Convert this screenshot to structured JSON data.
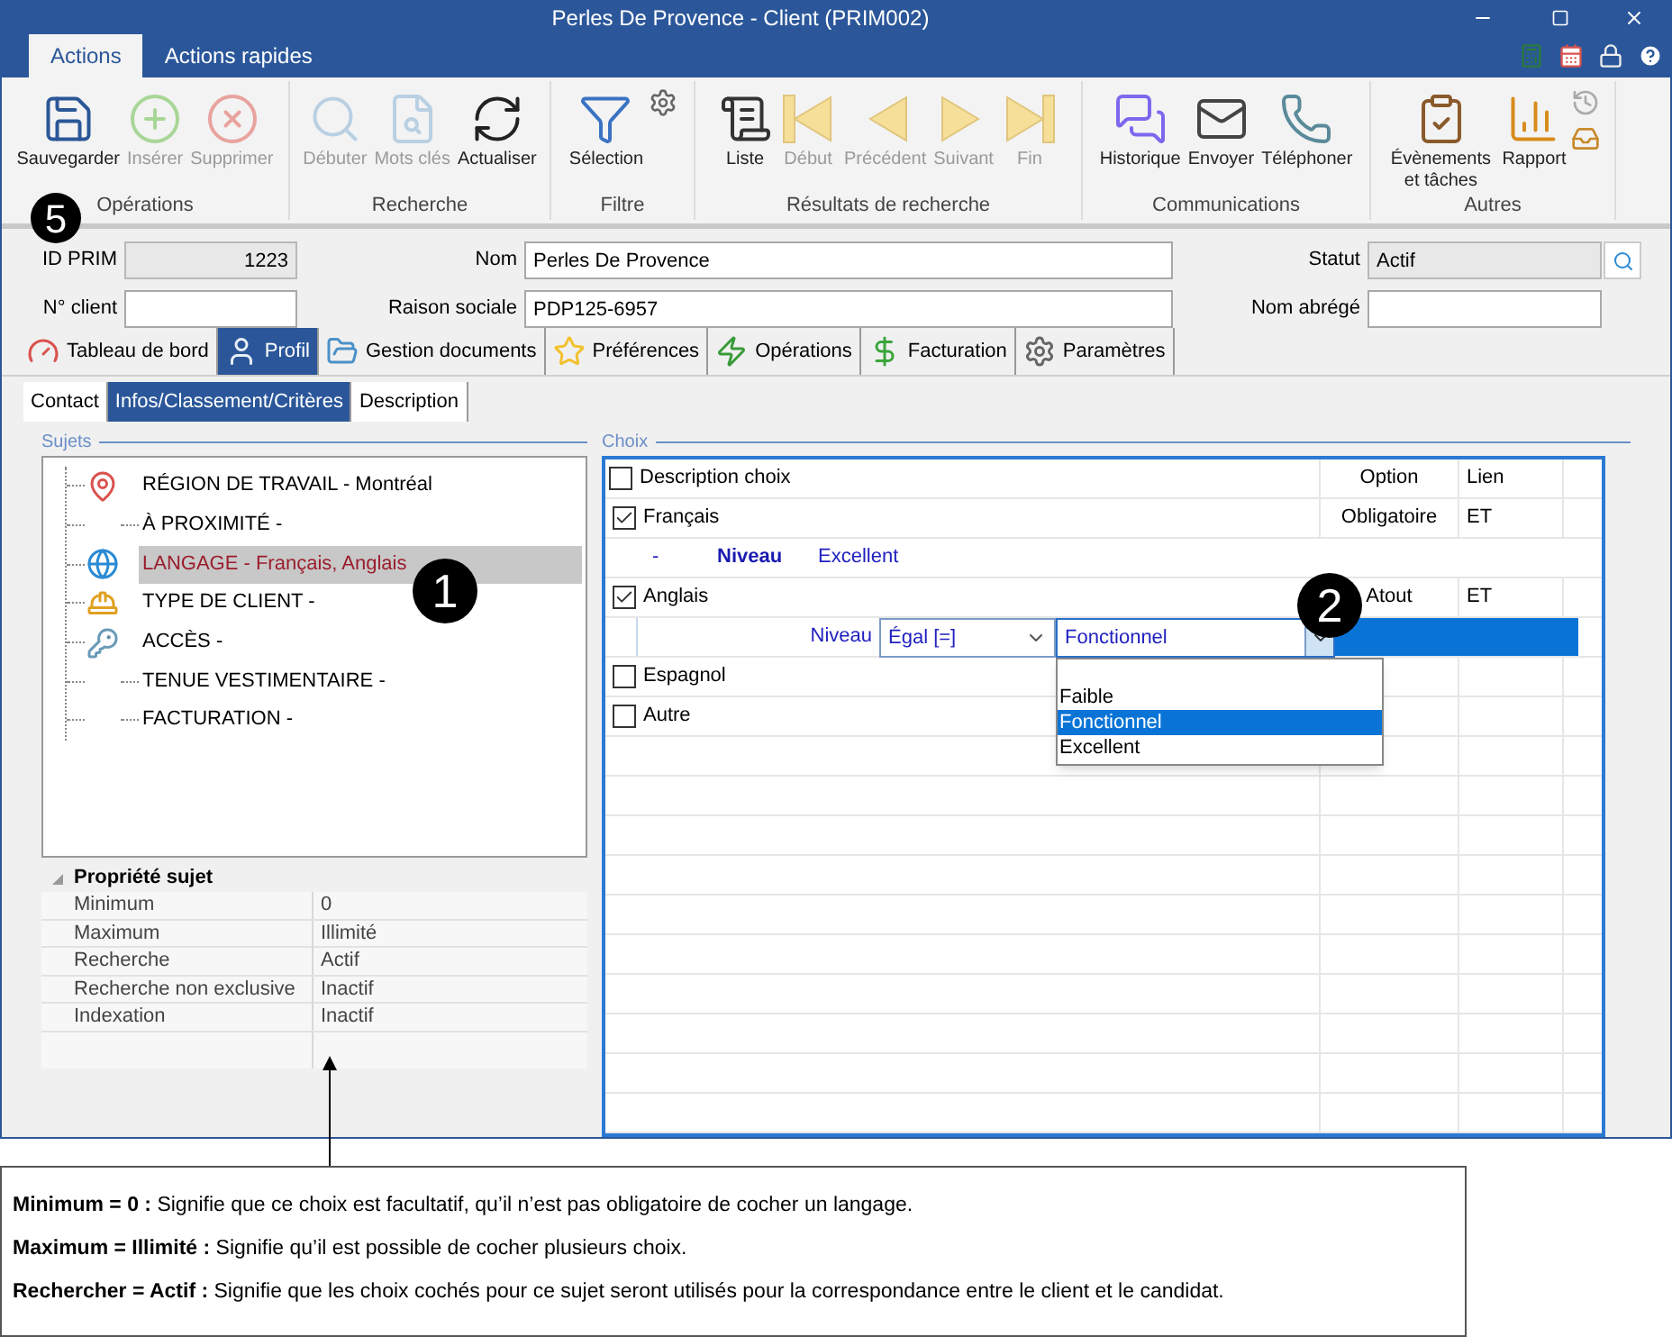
{
  "window": {
    "title": "Perles De Provence - Client (PRIM002)"
  },
  "ribbon_tabs": [
    {
      "label": "Actions",
      "selected": true
    },
    {
      "label": "Actions rapides",
      "selected": false
    }
  ],
  "ribbon_groups": [
    {
      "label": "Opérations",
      "buttons": [
        {
          "label": "Sauvegarder",
          "kind": "save",
          "disabled": false
        },
        {
          "label": "Insérer",
          "kind": "add",
          "disabled": true
        },
        {
          "label": "Supprimer",
          "kind": "delete",
          "disabled": true
        }
      ]
    },
    {
      "label": "Recherche",
      "buttons": [
        {
          "label": "Débuter",
          "kind": "search",
          "disabled": true
        },
        {
          "label": "Mots clés",
          "kind": "keywords",
          "disabled": true
        },
        {
          "label": "Actualiser",
          "kind": "refresh",
          "disabled": false
        }
      ]
    },
    {
      "label": "Filtre",
      "buttons": [
        {
          "label": "Sélection",
          "kind": "filter",
          "disabled": false
        },
        {
          "kind": "gear-small",
          "disabled": false
        }
      ]
    },
    {
      "label": "Résultats de recherche",
      "buttons": [
        {
          "label": "Liste",
          "kind": "list",
          "disabled": false
        },
        {
          "label": "Début",
          "kind": "first",
          "disabled": true
        },
        {
          "label": "Précédent",
          "kind": "prev",
          "disabled": true
        },
        {
          "label": "Suivant",
          "kind": "next",
          "disabled": true
        },
        {
          "label": "Fin",
          "kind": "last",
          "disabled": true
        }
      ]
    },
    {
      "label": "Communications",
      "buttons": [
        {
          "label": "Historique",
          "kind": "history",
          "disabled": false
        },
        {
          "label": "Envoyer",
          "kind": "send",
          "disabled": false
        },
        {
          "label": "Téléphoner",
          "kind": "phone",
          "disabled": false
        }
      ]
    },
    {
      "label": "Autres",
      "buttons": [
        {
          "label": "Évènements et tâches",
          "kind": "tasks",
          "disabled": false
        },
        {
          "label": "Rapport",
          "kind": "report",
          "disabled": false
        },
        {
          "kind": "stack-small",
          "disabled": false
        }
      ]
    }
  ],
  "fields": [
    {
      "label": "ID PRIM",
      "value": "1223",
      "readonly": true
    },
    {
      "label": "Nom",
      "value": "Perles De Provence",
      "readonly": false
    },
    {
      "label": "Statut",
      "value": "Actif",
      "readonly": true
    },
    {
      "label": "N° client",
      "readonly": false
    },
    {
      "label": "Raison sociale",
      "value": "PDP125-6957",
      "readonly": false
    },
    {
      "label": "Nom abrégé",
      "readonly": false
    }
  ],
  "tabs": [
    {
      "label": "Tableau de bord",
      "kind": "dashboard",
      "selected": false
    },
    {
      "label": "Profil",
      "kind": "user",
      "selected": true
    },
    {
      "label": "Gestion documents",
      "kind": "folder",
      "selected": false
    },
    {
      "label": "Préférences",
      "kind": "star",
      "selected": false
    },
    {
      "label": "Opérations",
      "kind": "operations",
      "selected": false
    },
    {
      "label": "Facturation",
      "kind": "dollar",
      "selected": false
    },
    {
      "label": "Paramètres",
      "kind": "gear",
      "selected": false
    }
  ],
  "subtabs": [
    {
      "label": "Contact",
      "selected": false
    },
    {
      "label": "Infos/Classement/Critères",
      "selected": true
    },
    {
      "label": "Description",
      "selected": false
    }
  ],
  "sujets": {
    "title": "Sujets",
    "items": [
      {
        "label": "RÉGION DE TRAVAIL - Montréal",
        "kind": "pin",
        "selected": false
      },
      {
        "label": "À PROXIMITÉ -",
        "kind": "none",
        "selected": false
      },
      {
        "label": "LANGAGE - Français, Anglais",
        "kind": "globe",
        "selected": true
      },
      {
        "label": "TYPE DE CLIENT -",
        "kind": "worker",
        "selected": false
      },
      {
        "label": "ACCÈS -",
        "kind": "key",
        "selected": false
      },
      {
        "label": "TENUE VESTIMENTAIRE -",
        "kind": "none",
        "selected": false
      },
      {
        "label": "FACTURATION -",
        "kind": "none",
        "selected": false
      }
    ]
  },
  "property_grid": {
    "title": "Propriété sujet",
    "rows": [
      {
        "name": "Minimum",
        "value": "0"
      },
      {
        "name": "Maximum",
        "value": "Illimité"
      },
      {
        "name": "Recherche",
        "value": "Actif"
      },
      {
        "name": "Recherche non exclusive",
        "value": "Inactif"
      },
      {
        "name": "Indexation",
        "value": "Inactif"
      }
    ]
  },
  "choix": {
    "title": "Choix",
    "header": {
      "checked": false,
      "label": "Description choix",
      "option": "Option",
      "lien": "Lien"
    },
    "rows": [
      {
        "kind": "choice",
        "checked": true,
        "label": "Français",
        "option": "Obligatoire",
        "lien": "ET"
      },
      {
        "kind": "detail",
        "dash": "-",
        "label": "Niveau",
        "value": "Excellent"
      },
      {
        "kind": "choice",
        "checked": true,
        "label": "Anglais",
        "option": "Atout",
        "lien": "ET"
      },
      {
        "kind": "editor",
        "label": "Niveau",
        "operator": "Égal [=]",
        "value": "Fonctionnel",
        "options": [
          {
            "label": "Faible",
            "selected": false
          },
          {
            "label": "Fonctionnel",
            "selected": true
          },
          {
            "label": "Excellent",
            "selected": false
          }
        ]
      },
      {
        "kind": "choice",
        "checked": false,
        "label": "Espagnol"
      },
      {
        "kind": "choice",
        "checked": false,
        "label": "Autre"
      }
    ]
  },
  "callouts": [
    {
      "label": "5",
      "kind": "ribbon"
    },
    {
      "label": "1",
      "kind": "tree"
    },
    {
      "label": "2",
      "kind": "grid"
    }
  ],
  "notes": [
    "**Minimum = 0 :** Signifie que ce choix est facultatif, qu’il n’est pas obligatoire de cocher un langage.",
    "**Maximum = Illimité :** Signifie qu’il est possible de cocher plusieurs choix.",
    "**Rechercher = Actif :** Signifie que les choix cochés pour ce sujet seront utilisés pour la correspondance entre le client et le candidat."
  ]
}
